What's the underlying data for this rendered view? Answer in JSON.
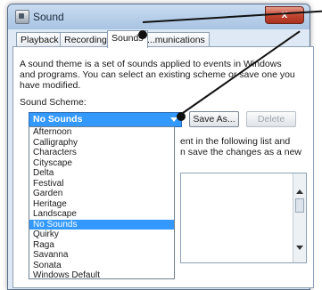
{
  "window": {
    "title": "Sound",
    "close_label": "x"
  },
  "tabs": [
    {
      "label": "Playback",
      "active": false
    },
    {
      "label": "Recording",
      "active": false
    },
    {
      "label": "Sounds",
      "active": true
    },
    {
      "label": "Communications",
      "active": false,
      "visible_text": "...munications"
    }
  ],
  "sounds": {
    "description": "A sound theme is a set of sounds applied to events in Windows\nand programs.  You can select an existing scheme or save one you\nhave modified.",
    "scheme_label": "Sound Scheme:",
    "selected_scheme": "No Sounds",
    "save_as_label": "Save As...",
    "delete_label": "Delete",
    "partial_text": "ent in the following list and\nn save the changes as a new",
    "scheme_options": [
      "Afternoon",
      "Calligraphy",
      "Characters",
      "Cityscape",
      "Delta",
      "Festival",
      "Garden",
      "Heritage",
      "Landscape",
      "No Sounds",
      "Quirky",
      "Raga",
      "Savanna",
      "Sonata",
      "Windows Default"
    ]
  },
  "colors": {
    "selection": "#3399ff",
    "close_button": "#c1442f",
    "callout": "#111111"
  }
}
